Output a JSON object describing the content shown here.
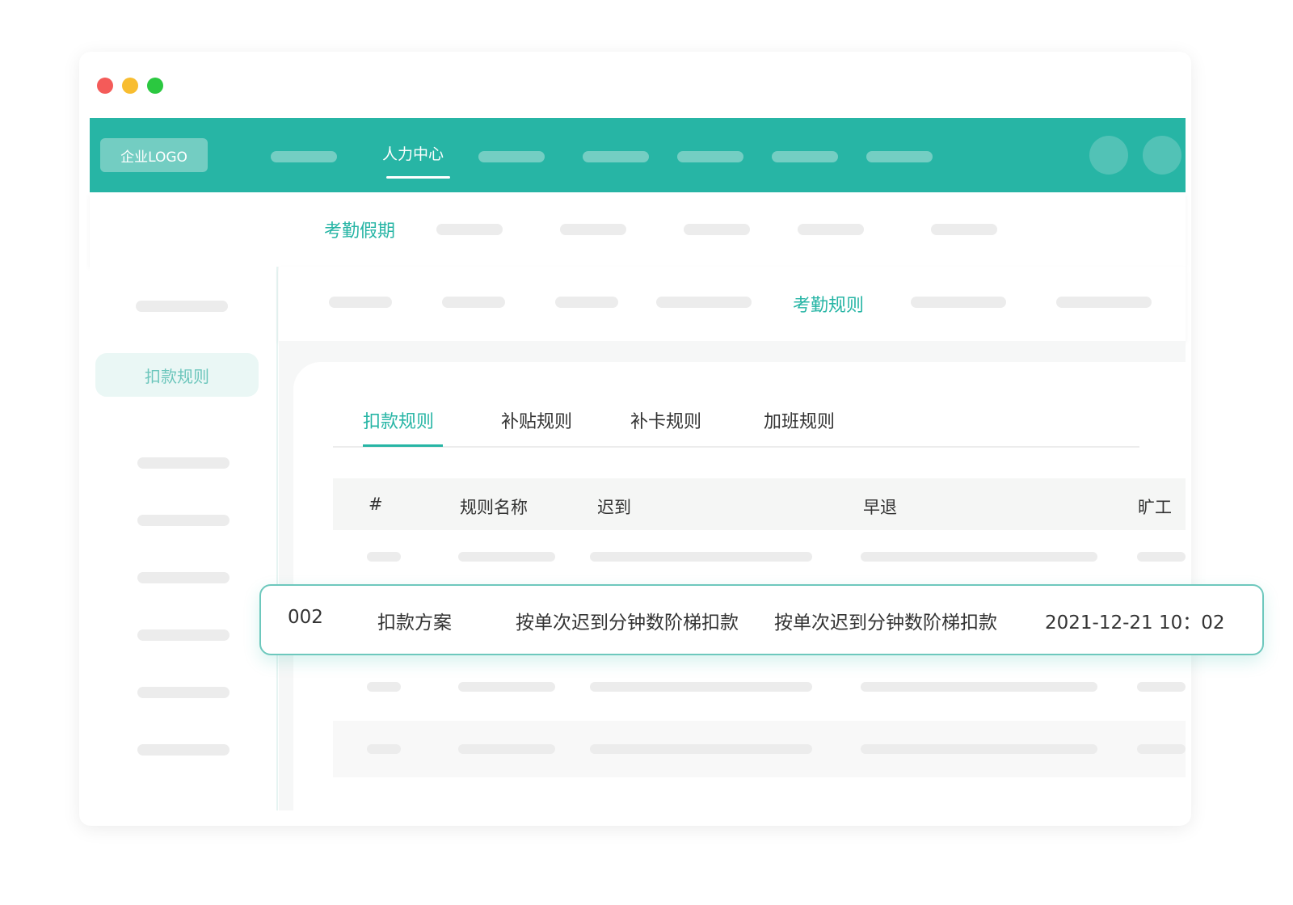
{
  "window": {
    "controls": [
      "close",
      "minimize",
      "maximize"
    ]
  },
  "colors": {
    "primary": "#27b5a5",
    "primary_light": "#73cdc2",
    "highlight_border": "#6dc8bd"
  },
  "topnav": {
    "logo": "企业LOGO",
    "active_item": "人力中心"
  },
  "subnav": {
    "active_item": "考勤假期"
  },
  "sidebar": {
    "active_item": "扣款规则"
  },
  "breadcrumb": {
    "active_item": "考勤规则"
  },
  "tabs": [
    "扣款规则",
    "补贴规则",
    "补卡规则",
    "加班规则"
  ],
  "table": {
    "columns": [
      "#",
      "规则名称",
      "迟到",
      "早退",
      "旷工"
    ],
    "highlighted_row": [
      "002",
      "扣款方案",
      "按单次迟到分钟数阶梯扣款",
      "按单次迟到分钟数阶梯扣款",
      "2021-12-21 10：02"
    ]
  }
}
